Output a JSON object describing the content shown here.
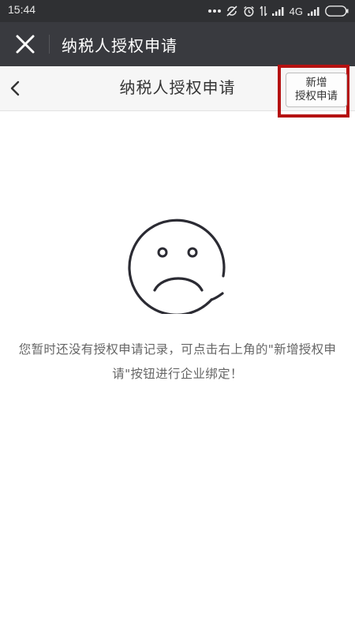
{
  "status_bar": {
    "time": "15:44",
    "network": "4G"
  },
  "app_bar": {
    "title": "纳税人授权申请",
    "close_icon": "close-icon"
  },
  "nav_bar": {
    "title": "纳税人授权申请",
    "back_icon": "chevron-left-icon",
    "add_button_line1": "新增",
    "add_button_line2": "授权申请",
    "highlight_color": "#b51111"
  },
  "empty_state": {
    "icon": "sad-face-icon",
    "message": "您暂时还没有授权申请记录，可点击右上角的\"新增授权申请\"按钮进行企业绑定！"
  }
}
